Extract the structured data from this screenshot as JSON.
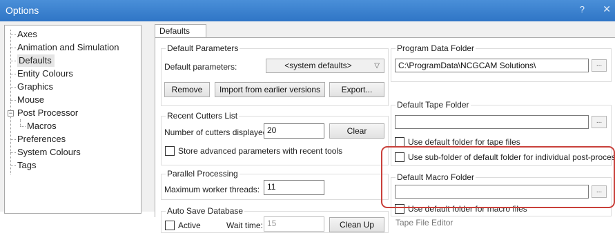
{
  "window": {
    "title": "Options",
    "help": "?",
    "close": "✕"
  },
  "tree": {
    "items": [
      {
        "label": "Axes"
      },
      {
        "label": "Animation and Simulation"
      },
      {
        "label": "Defaults"
      },
      {
        "label": "Entity Colours"
      },
      {
        "label": "Graphics"
      },
      {
        "label": "Mouse"
      },
      {
        "label": "Post Processor"
      },
      {
        "label": "Macros"
      },
      {
        "label": "Preferences"
      },
      {
        "label": "System Colours"
      },
      {
        "label": "Tags"
      }
    ],
    "selected": "Defaults"
  },
  "tab": {
    "label": "Defaults"
  },
  "default_parameters": {
    "title": "Default Parameters",
    "label": "Default parameters:",
    "value": "<system defaults>",
    "remove": "Remove",
    "import": "Import from earlier versions",
    "export": "Export..."
  },
  "recent_cutters": {
    "title": "Recent Cutters List",
    "count_label": "Number of cutters displayed:",
    "count_value": "20",
    "clear": "Clear",
    "store_label": "Store advanced parameters with recent tools",
    "store_checked": false
  },
  "parallel": {
    "title": "Parallel Processing",
    "label": "Maximum worker threads:",
    "value": "11"
  },
  "autosave": {
    "title": "Auto Save Database",
    "active_label": "Active",
    "wait_label": "Wait time:",
    "wait_value": "15",
    "cleanup": "Clean Up"
  },
  "program_data": {
    "title": "Program Data Folder",
    "path": "C:\\ProgramData\\NCGCAM Solutions\\",
    "browse": "..."
  },
  "tape_folder": {
    "title": "Default Tape Folder",
    "path": "",
    "browse": "...",
    "use_default_label": "Use default folder for tape files",
    "use_sub_label": "Use sub-folder of default folder for individual post-processor files"
  },
  "macro_folder": {
    "title": "Default Macro Folder",
    "path": "",
    "browse": "...",
    "use_default_label": "Use default folder for macro files"
  },
  "tape_editor": {
    "title": "Tape File Editor"
  },
  "colors": {
    "titlebar": "#2f75c6",
    "highlight": "#c9403a"
  }
}
